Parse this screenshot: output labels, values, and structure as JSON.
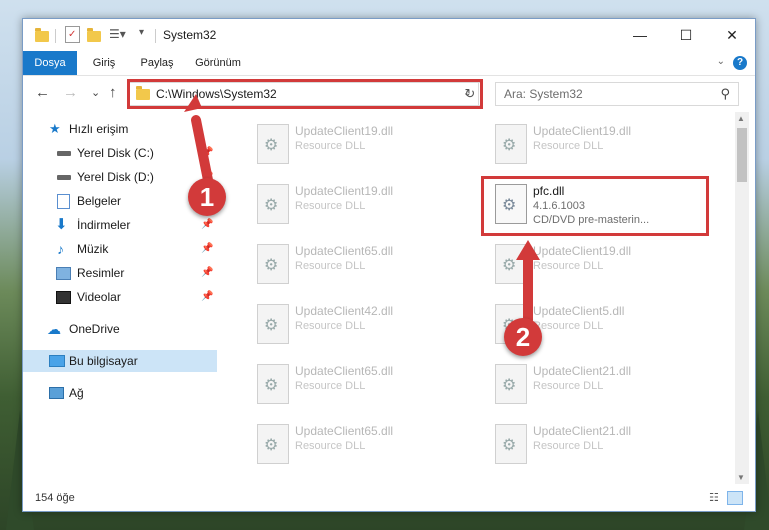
{
  "window": {
    "title": "System32",
    "minimize": "—",
    "maximize": "☐",
    "close": "✕"
  },
  "ribbon": {
    "tabs": [
      "Dosya",
      "Giriş",
      "Paylaş",
      "Görünüm"
    ],
    "help": "?"
  },
  "nav": {
    "back": "←",
    "forward": "→",
    "recent": "⌄",
    "up": "↑",
    "address": "C:\\Windows\\System32",
    "address_dropdown": "⌄",
    "refresh": "↻",
    "search_placeholder": "Ara: System32",
    "search_icon": "⚲"
  },
  "sidebar": {
    "items": [
      {
        "label": "Hızlı erişim",
        "icon": "star-icon",
        "pinned": false
      },
      {
        "label": "Yerel Disk (C:)",
        "icon": "disk-icon",
        "pinned": true
      },
      {
        "label": "Yerel Disk (D:)",
        "icon": "disk-icon",
        "pinned": true
      },
      {
        "label": "Belgeler",
        "icon": "document-icon",
        "pinned": true
      },
      {
        "label": "İndirmeler",
        "icon": "download-icon",
        "pinned": true
      },
      {
        "label": "Müzik",
        "icon": "music-icon",
        "pinned": true
      },
      {
        "label": "Resimler",
        "icon": "picture-icon",
        "pinned": true
      },
      {
        "label": "Videolar",
        "icon": "video-icon",
        "pinned": true
      },
      {
        "label": "OneDrive",
        "icon": "cloud-icon",
        "pinned": false
      },
      {
        "label": "Bu bilgisayar",
        "icon": "computer-icon",
        "pinned": false
      },
      {
        "label": "Ağ",
        "icon": "network-icon",
        "pinned": false
      }
    ],
    "pin_glyph": "📌"
  },
  "files": {
    "left_column": [
      {
        "name": "UpdateClient19.dll",
        "desc": "Resource DLL"
      },
      {
        "name": "UpdateClient19.dll",
        "desc": "Resource DLL"
      },
      {
        "name": "UpdateClient65.dll",
        "desc": "Resource DLL"
      },
      {
        "name": "UpdateClient42.dll",
        "desc": "Resource DLL"
      },
      {
        "name": "UpdateClient65.dll",
        "desc": "Resource DLL"
      },
      {
        "name": "UpdateClient65.dll",
        "desc": "Resource DLL"
      }
    ],
    "right_column": [
      {
        "name": "UpdateClient19.dll",
        "desc": "Resource DLL"
      },
      {
        "name": "pfc.dll",
        "version": "4.1.6.1003",
        "desc": "CD/DVD pre-masterin..."
      },
      {
        "name": "UpdateClient19.dll",
        "desc": "Resource DLL"
      },
      {
        "name": "UpdateClient5.dll",
        "desc": "Resource DLL"
      },
      {
        "name": "UpdateClient21.dll",
        "desc": "Resource DLL"
      },
      {
        "name": "UpdateClient21.dll",
        "desc": "Resource DLL"
      }
    ]
  },
  "status": {
    "count": "154 öğe"
  },
  "annotations": {
    "badge1": "1",
    "badge2": "2",
    "color": "#d23a3a"
  }
}
